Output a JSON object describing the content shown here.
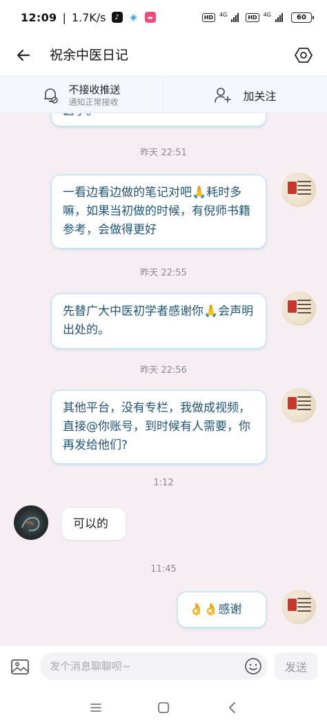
{
  "status_bar": {
    "time": "12:09",
    "speed": "1.7K/s",
    "network_1": "4G",
    "network_2": "4G",
    "hd_1": "HD",
    "hd_2": "HD",
    "battery": "60"
  },
  "header": {
    "title": "祝余中医日记",
    "back_icon": "arrow-left-icon",
    "settings_icon": "hexagon-settings-icon"
  },
  "subscription": {
    "notify_title": "不接收推送",
    "notify_sub": "通知正常接收",
    "follow_label": "加关注"
  },
  "messages": {
    "partial_text": "医学。",
    "t1": "昨天 22:51",
    "m1": "一看边看边做的笔记对吧🙏耗时多嘛，如果当初做的时候，有倪师书籍参考，会做得更好",
    "t2": "昨天 22:55",
    "m2": "先替广大中医初学者感谢你🙏会声明出处的。",
    "t3": "昨天 22:56",
    "m3": "其他平台，没有专栏，我做成视频，直接@你账号，到时候有人需要，你再发给他们?",
    "t4": "1:12",
    "m4": "可以的",
    "t5": "11:45",
    "m5": "👌👌感谢"
  },
  "input": {
    "placeholder": "发个消息聊聊呗~",
    "send_label": "发送"
  },
  "colors": {
    "bubble_border": "#bfe6f1",
    "bubble_text": "#1f4e6e",
    "chat_bg": "#f6eef3"
  }
}
